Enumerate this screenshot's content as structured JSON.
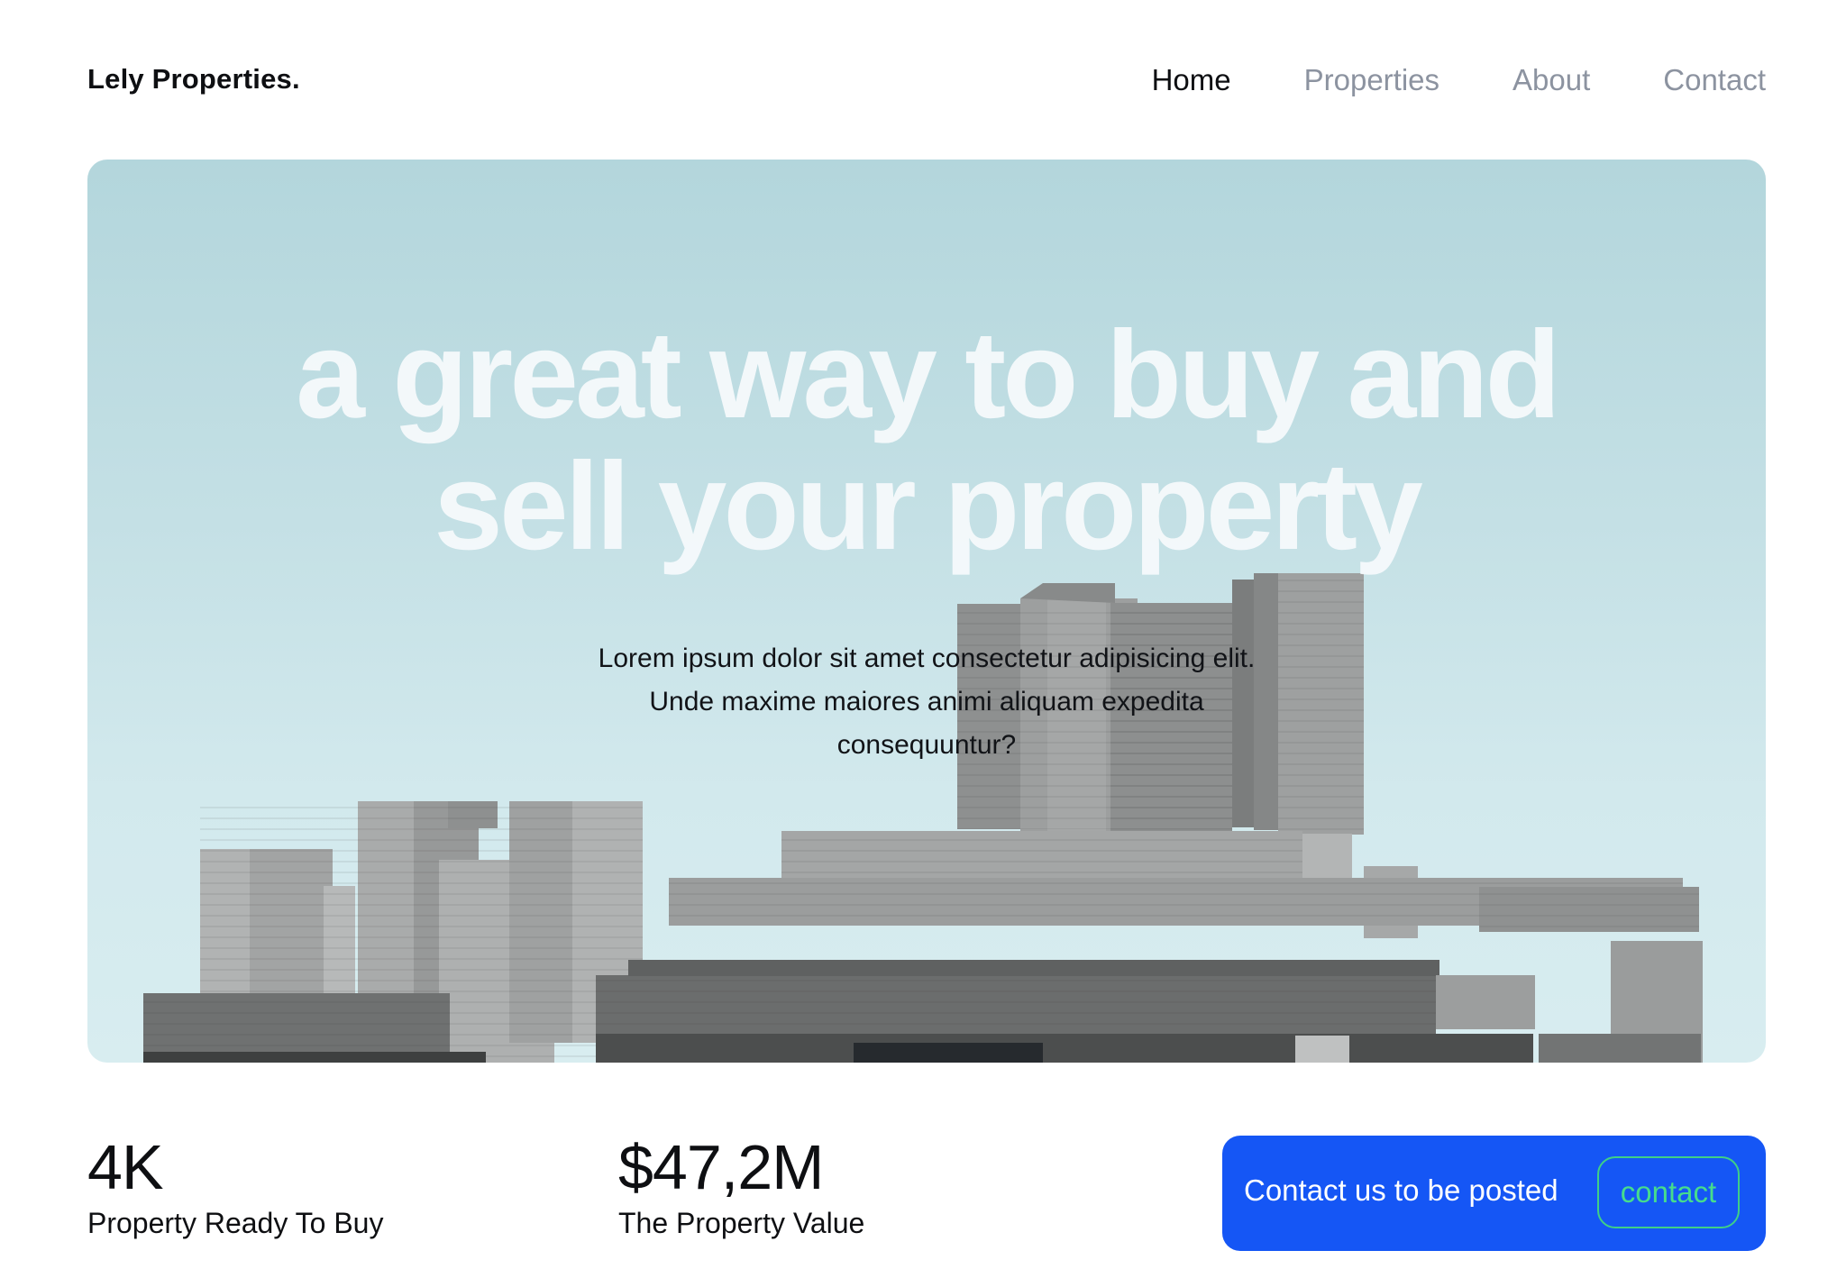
{
  "header": {
    "logo": "Lely Properties.",
    "nav": [
      {
        "label": "Home",
        "active": true
      },
      {
        "label": "Properties",
        "active": false
      },
      {
        "label": "About",
        "active": false
      },
      {
        "label": "Contact",
        "active": false
      }
    ]
  },
  "hero": {
    "title_line1": "a great way to buy and",
    "title_line2": "sell your property",
    "description": "Lorem ipsum dolor sit amet consectetur adipisicing elit. Unde maxime maiores animi aliquam expedita consequuntur?"
  },
  "stats": [
    {
      "value": "4K",
      "label": "Property Ready To Buy"
    },
    {
      "value": "$47,2M",
      "label": "The Property Value"
    }
  ],
  "cta": {
    "text": "Contact us to be posted",
    "button_label": "contact"
  },
  "colors": {
    "accent_blue": "#1556f5",
    "contact_green": "#46dc8d",
    "nav_inactive": "#8c93a0"
  }
}
